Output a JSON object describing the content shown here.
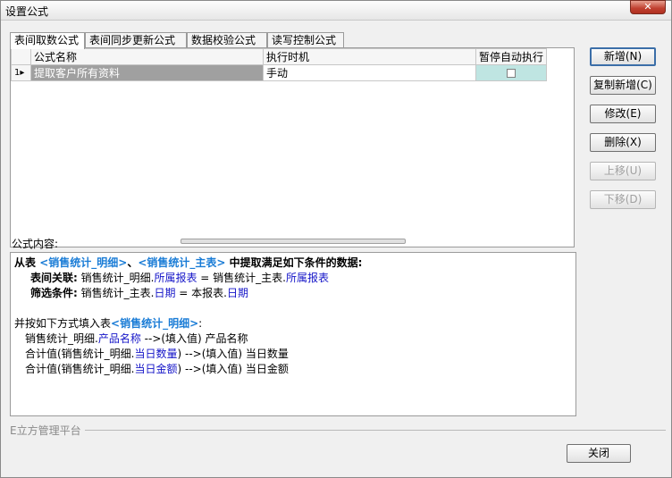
{
  "window": {
    "title": "设置公式",
    "close_glyph": "✕"
  },
  "tabs": [
    "表间取数公式",
    "表间同步更新公式",
    "数据校验公式",
    "读写控制公式"
  ],
  "grid": {
    "headers": {
      "name": "公式名称",
      "exec": "执行时机",
      "pause": "暂停自动执行"
    },
    "rows": [
      {
        "num": "1",
        "name": "提取客户所有资料",
        "exec": "手动",
        "pause": false
      }
    ]
  },
  "content_label": "公式内容:",
  "content": {
    "line1": {
      "p1": "从表",
      "t1": "<销售统计_明细>",
      "p2": "、",
      "t2": "<销售统计_主表>",
      "p3": "中提取满足如下条件的数据:"
    },
    "line2": {
      "label": "表间关联:",
      "p1": "销售统计_明细.",
      "f1": "所属报表",
      "p2": " = 销售统计_主表.",
      "f2": "所属报表"
    },
    "line3": {
      "label": "筛选条件:",
      "p1": "销售统计_主表.",
      "f1": "日期",
      "p2": " = 本报表.",
      "f2": "日期"
    },
    "line5": {
      "p1": "并按如下方式填入表",
      "t1": "<销售统计_明细>",
      "p2": ":"
    },
    "line6": {
      "p1": "销售统计_明细.",
      "f1": "产品名称",
      "p2": " -->(填入值) 产品名称"
    },
    "line7": {
      "p1": "合计值(销售统计_明细.",
      "f1": "当日数量",
      "p2": ") -->(填入值) 当日数量"
    },
    "line8": {
      "p1": "合计值(销售统计_明细.",
      "f1": "当日金额",
      "p2": ") -->(填入值) 当日金额"
    }
  },
  "buttons": {
    "add": "新增(N)",
    "copy_add": "复制新增(C)",
    "edit": "修改(E)",
    "delete": "删除(X)",
    "move_up": "上移(U)",
    "move_down": "下移(D)"
  },
  "footer": {
    "label": "E立方管理平台",
    "close": "关闭"
  }
}
